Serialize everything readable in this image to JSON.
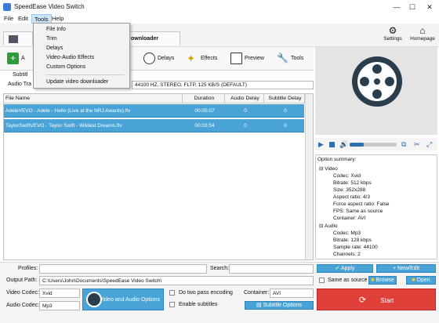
{
  "window": {
    "title": "SpeedEase Video Switch"
  },
  "menu": {
    "file": "File",
    "edit": "Edit",
    "tools": "Tools",
    "help": "Help"
  },
  "tools_menu": {
    "items": [
      "File Info",
      "Trim",
      "Delays",
      "Video-Audio Effects",
      "Custom Options"
    ],
    "last": "Update video downloader"
  },
  "tabs": {
    "downloader": "ownloader"
  },
  "topbar": {
    "settings": "Settings",
    "homepage": "Homepage"
  },
  "actions": {
    "add_partial": "A",
    "delays": "Delays",
    "effects": "Effects",
    "preview": "Preview",
    "tools": "Tools"
  },
  "subtitle_label": "Subtitl",
  "audio_track": {
    "label": "Audio Tra",
    "value": "44100 HZ, STEREO, FLTP, 125 KB/S (DEFAULT)"
  },
  "table": {
    "headers": [
      "File Name",
      "Duration",
      "Audio Delay",
      "Subtitle Delay"
    ],
    "rows": [
      {
        "name": "AdeleVEVO - Adele - Hello (Live at the NRJ Awards).flv",
        "duration": "00:05:07",
        "audio_delay": "0",
        "subtitle_delay": "0"
      },
      {
        "name": "TaylorSwiftVEVO - Taylor Swift - Wildest Dreams.flv",
        "duration": "00:03:54",
        "audio_delay": "0",
        "subtitle_delay": "0"
      }
    ]
  },
  "summary": {
    "title": "Option summary:",
    "video_header": "Video",
    "video": [
      "Codec: Xvid",
      "Bitrate: 512 kbps",
      "Size: 352x288",
      "Aspect ratio: 4/3",
      "Force aspect ratio: False",
      "FPS: Same as source",
      "Container: AVI"
    ],
    "audio_header": "Audio",
    "audio": [
      "Codec: Mp3",
      "Bitrate: 128 kbps",
      "Sample rate: 44100",
      "Channels: 2"
    ]
  },
  "bottom": {
    "profiles_label": "Profiles:",
    "search_label": "Search:",
    "apply": "Apply",
    "new_edit": "New/Edit",
    "output_label": "Output Path:",
    "output_value": "C:\\Users\\John\\Documents\\SpeedEase Video Switch\\",
    "same_as_source": "Same as source",
    "browse": "Browse",
    "open": "Open",
    "video_codec_label": "Video Codec:",
    "video_codec": "Xvid",
    "audio_codec_label": "Audio Codec:",
    "audio_codec": "Mp3",
    "va_options": "Video and Audio Options",
    "two_pass": "Do two pass encoding",
    "enable_subtitles": "Enable subtitles",
    "container_label": "Container:",
    "container": "AVI",
    "subtitle_options": "Subtitle Options",
    "start": "Start"
  },
  "colors": {
    "accent": "#4aa3d6",
    "start": "#e0403a",
    "selection": "#4aa3d6"
  }
}
